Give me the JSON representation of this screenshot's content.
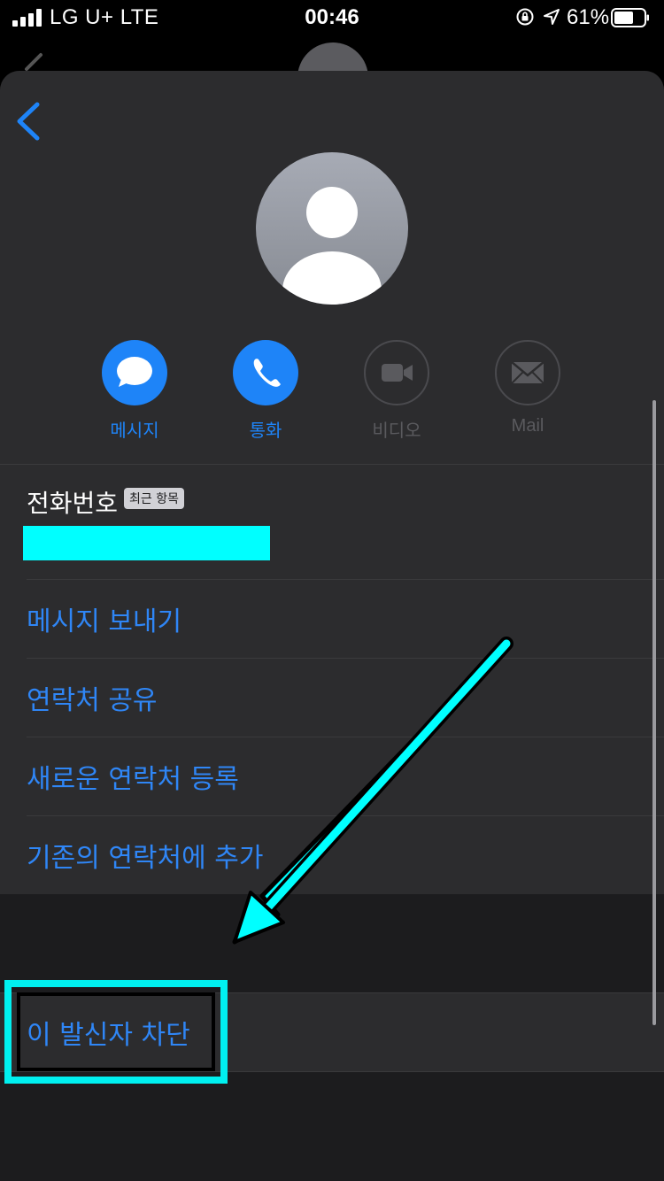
{
  "status_bar": {
    "carrier": "LG U+  LTE",
    "time": "00:46",
    "battery_percent": "61%"
  },
  "actions": [
    {
      "label": "메시지",
      "icon": "message-bubble-icon",
      "enabled": true
    },
    {
      "label": "통화",
      "icon": "phone-icon",
      "enabled": true
    },
    {
      "label": "비디오",
      "icon": "video-camera-icon",
      "enabled": false
    },
    {
      "label": "Mail",
      "icon": "envelope-icon",
      "enabled": false
    }
  ],
  "phone": {
    "label": "전화번호",
    "badge": "최근 항목"
  },
  "menu_items": [
    "메시지 보내기",
    "연락처 공유",
    "새로운 연락처 등록",
    "기존의 연락처에 추가"
  ],
  "block_sender": "이 발신자 차단",
  "colors": {
    "accent": "#1e84f8",
    "highlight": "#00ffff",
    "sheet_bg": "#2c2c2e"
  }
}
